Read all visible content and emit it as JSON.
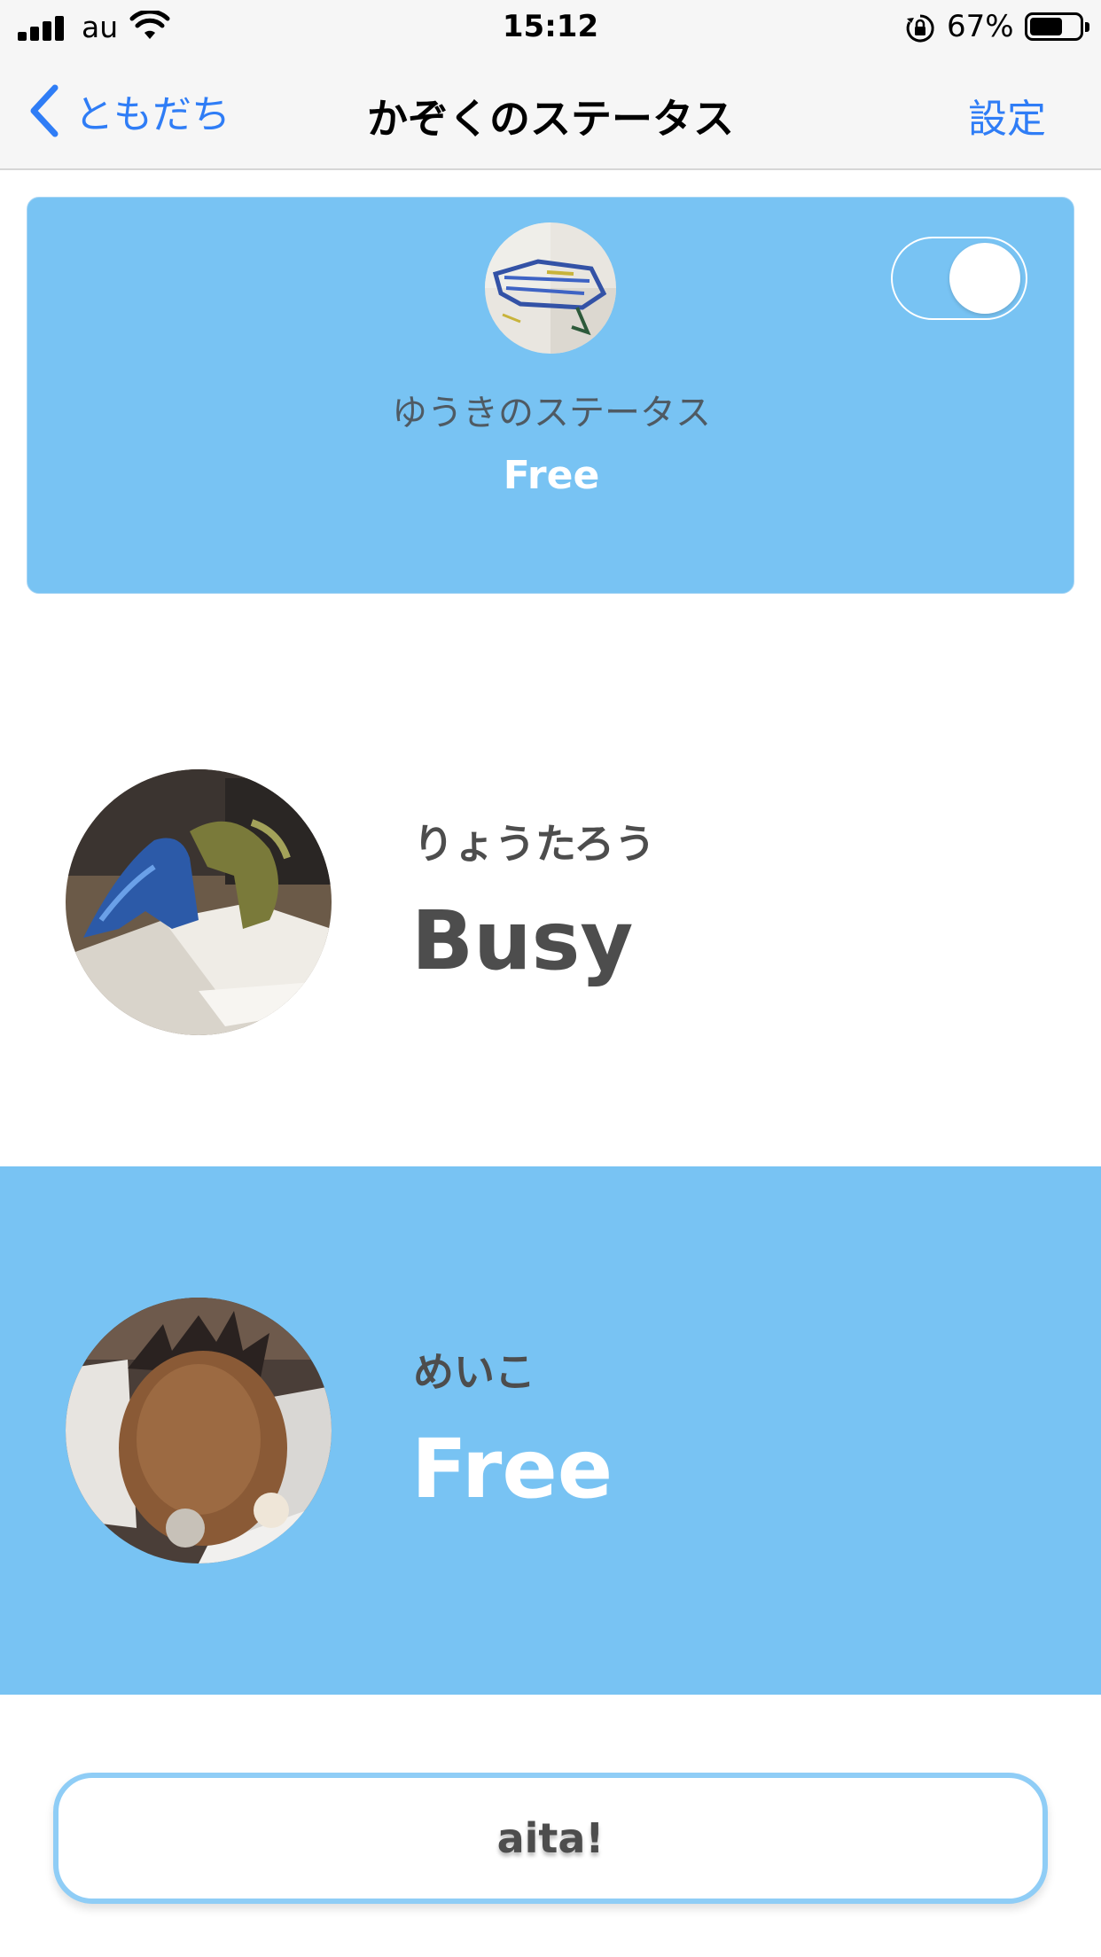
{
  "status_bar": {
    "carrier": "au",
    "time": "15:12",
    "battery_percent": "67%",
    "battery_level": 0.67,
    "icons": [
      "signal-icon",
      "wifi-icon",
      "orientation-lock-icon",
      "battery-icon"
    ]
  },
  "nav": {
    "back_label": "ともだち",
    "title": "かぞくのステータス",
    "settings_label": "設定"
  },
  "my_card": {
    "label": "ゆうきのステータス",
    "status": "Free",
    "toggle_on": true,
    "background_color": "#78c3f3"
  },
  "members": [
    {
      "name": "りょうたろう",
      "status": "Busy",
      "background_color": "#ffffff"
    },
    {
      "name": "めいこ",
      "status": "Free",
      "background_color": "#78c3f3"
    }
  ],
  "aita_button": {
    "label": "aita!"
  },
  "colors": {
    "accent": "#2f7df6",
    "free": "#78c3f3"
  }
}
